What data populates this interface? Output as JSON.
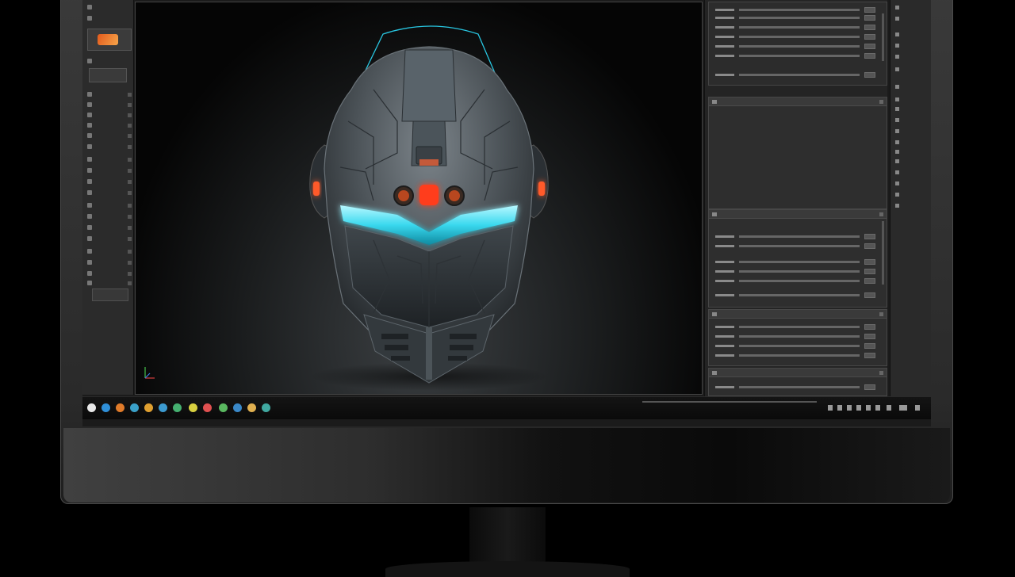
{
  "viewport": {
    "title": "",
    "subject": "helmet"
  },
  "left_panel": {
    "preset_label": "",
    "items": [
      "",
      "",
      "",
      "",
      "",
      "",
      "",
      "",
      "",
      "",
      "",
      "",
      "",
      "",
      "",
      "",
      "",
      "",
      "",
      "",
      ""
    ]
  },
  "right_panel": {
    "sections": [
      {
        "title": ""
      },
      {
        "title": ""
      },
      {
        "title": ""
      },
      {
        "title": ""
      },
      {
        "title": ""
      }
    ]
  },
  "tool_column": {
    "items": [
      "",
      "",
      "",
      "",
      "",
      "",
      "",
      "",
      "",
      "",
      "",
      "",
      "",
      "",
      "",
      "",
      "",
      "",
      ""
    ]
  },
  "taskbar": {
    "icons": [
      {
        "name": "start-icon",
        "color": "#e8e8e8"
      },
      {
        "name": "browser-icon",
        "color": "#2f8fd8"
      },
      {
        "name": "app-icon",
        "color": "#e07b2a"
      },
      {
        "name": "app-icon",
        "color": "#3aa0c8"
      },
      {
        "name": "app-icon",
        "color": "#e0a030"
      },
      {
        "name": "app-icon",
        "color": "#3c9ad0"
      },
      {
        "name": "app-icon",
        "color": "#45b070"
      },
      {
        "name": "app-icon",
        "color": "#d8d040"
      },
      {
        "name": "app-icon",
        "color": "#e05050"
      },
      {
        "name": "app-icon",
        "color": "#5ab860"
      },
      {
        "name": "app-icon",
        "color": "#3a88c8"
      },
      {
        "name": "app-icon",
        "color": "#e0b050"
      },
      {
        "name": "app-icon",
        "color": "#40a8a0"
      }
    ]
  },
  "colors": {
    "accent_visor": "#39d8ee",
    "accent_orange": "#ff4a1c"
  }
}
